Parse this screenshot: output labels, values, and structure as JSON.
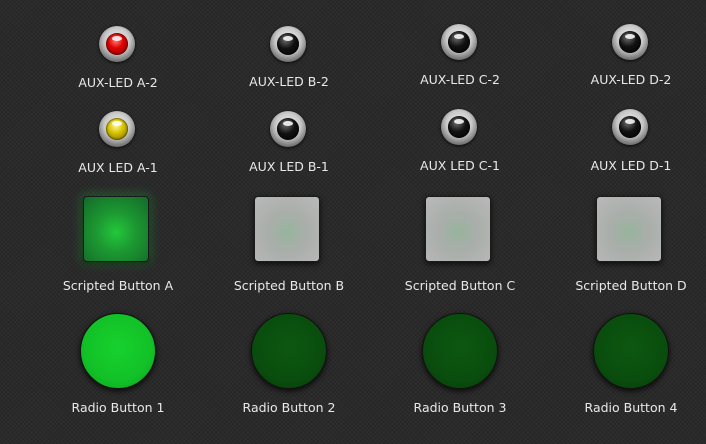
{
  "aux_leds_2": [
    {
      "label": "AUX-LED A-2",
      "state": "red"
    },
    {
      "label": "AUX-LED B-2",
      "state": "off"
    },
    {
      "label": "AUX-LED C-2",
      "state": "off"
    },
    {
      "label": "AUX-LED D-2",
      "state": "off"
    }
  ],
  "aux_leds_1": [
    {
      "label": "AUX LED A-1",
      "state": "yellow"
    },
    {
      "label": "AUX LED B-1",
      "state": "off"
    },
    {
      "label": "AUX LED C-1",
      "state": "off"
    },
    {
      "label": "AUX LED D-1",
      "state": "off"
    }
  ],
  "scripted_buttons": [
    {
      "label": "Scripted Button A",
      "state": "on"
    },
    {
      "label": "Scripted Button B",
      "state": "off"
    },
    {
      "label": "Scripted Button C",
      "state": "off"
    },
    {
      "label": "Scripted Button D",
      "state": "off"
    }
  ],
  "radio_buttons": [
    {
      "label": "Radio Button 1",
      "selected": true
    },
    {
      "label": "Radio Button 2",
      "selected": false
    },
    {
      "label": "Radio Button 3",
      "selected": false
    },
    {
      "label": "Radio Button 4",
      "selected": false
    }
  ],
  "colors": {
    "led_red": "#e00000",
    "led_yellow": "#d6c400",
    "active_green": "#12c127",
    "inactive_green": "#0a4d0e"
  }
}
